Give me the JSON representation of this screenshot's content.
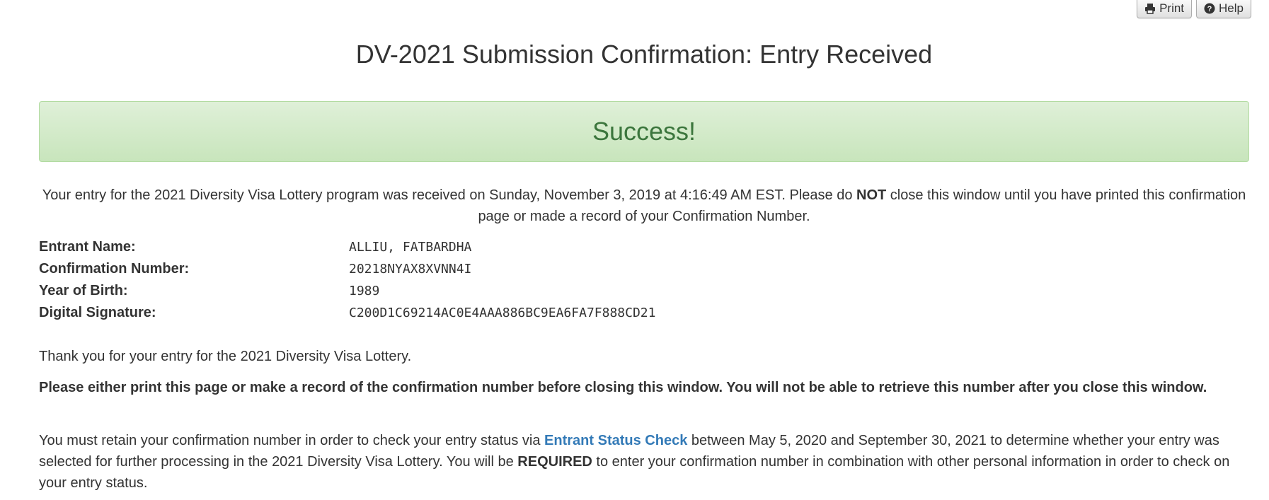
{
  "toolbar": {
    "print_label": "Print",
    "help_label": "Help"
  },
  "page": {
    "title": "DV-2021 Submission Confirmation: Entry Received"
  },
  "alert": {
    "text": "Success!"
  },
  "received": {
    "text_before": "Your entry for the 2021 Diversity Visa Lottery program was received on Sunday, November 3, 2019 at 4:16:49 AM EST. Please do ",
    "emphasis": "NOT",
    "text_after": " close this window until you have printed this confirmation page or made a record of your Confirmation Number."
  },
  "entry": {
    "name_label": "Entrant Name:",
    "name_value": "ALLIU, FATBARDHA",
    "confirmation_label": "Confirmation Number:",
    "confirmation_value": "20218NYAX8XVNN4I",
    "birth_label": "Year of Birth:",
    "birth_value": "1989",
    "signature_label": "Digital Signature:",
    "signature_value": "C200D1C69214AC0E4AAA886BC9EA6FA7F888CD21"
  },
  "messages": {
    "thanks": "Thank you for your entry for the 2021 Diversity Visa Lottery.",
    "warning": "Please either print this page or make a record of the confirmation number before closing this window. You will not be able to retrieve this number after you close this window.",
    "retain_before": "You must retain your confirmation number in order to check your entry status via ",
    "status_link": "Entrant Status Check",
    "retain_middle": " between May 5, 2020 and September 30, 2021 to determine whether your entry was selected for further processing in the 2021 Diversity Visa Lottery. You will be ",
    "required": "REQUIRED",
    "retain_after": " to enter your confirmation number in combination with other personal information in order to check on your entry status."
  },
  "colors": {
    "success_text": "#3c763d",
    "success_bg": "#dff0d8",
    "link": "#337ab7"
  },
  "icons": {
    "print": "printer-icon",
    "help": "question-circle-icon"
  }
}
